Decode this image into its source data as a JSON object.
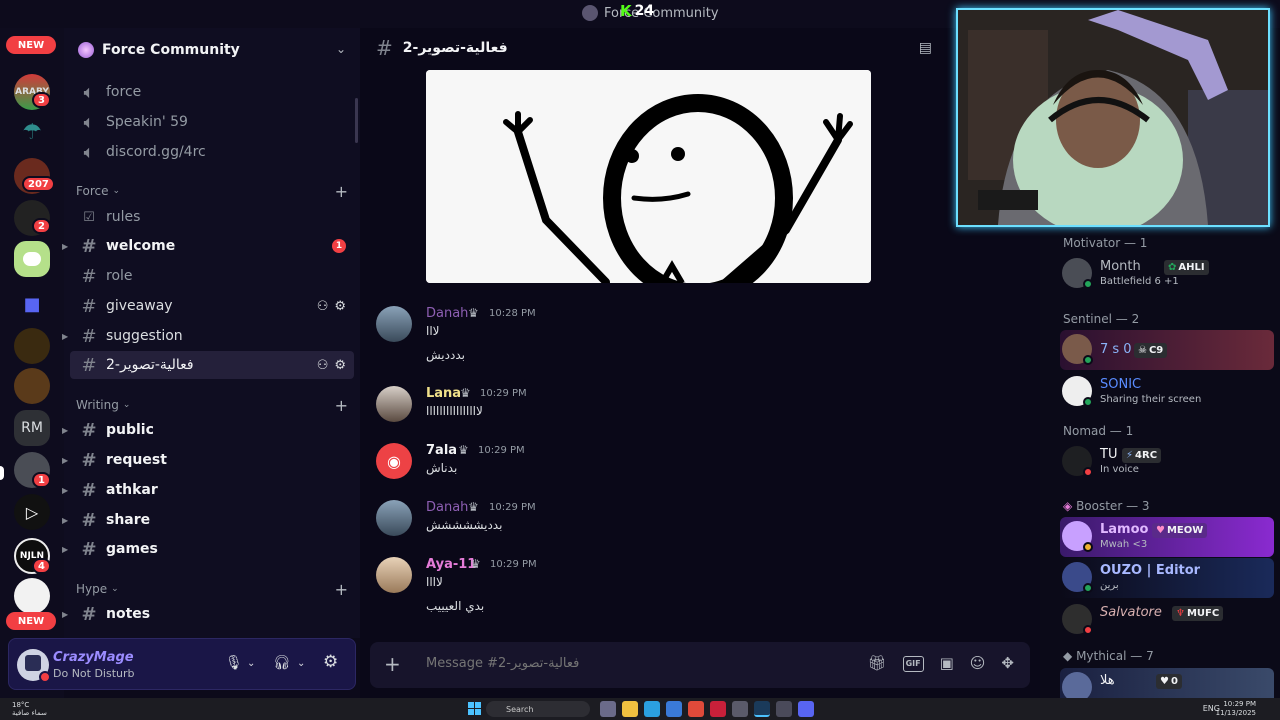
{
  "window": {
    "title": "Force Community",
    "kick_viewers": "24"
  },
  "rail": {
    "new_top": "NEW",
    "new_bottom": "NEW",
    "badges": [
      "3",
      "207",
      "2",
      "1",
      "4"
    ],
    "rm_label": "RM",
    "araby_label": "ARABY"
  },
  "server": {
    "name": "Force Community"
  },
  "channels_top": [
    {
      "label": "force",
      "icon": "speaker-icon"
    },
    {
      "label": "Speakin' 59",
      "icon": "speaker-icon"
    },
    {
      "label": "discord.gg/4rc",
      "icon": "speaker-icon"
    }
  ],
  "categories": {
    "force": "Force",
    "writing": "Writing",
    "hype": "Hype"
  },
  "force_channels": [
    {
      "label": "rules"
    },
    {
      "label": "welcome",
      "mentions": "1"
    },
    {
      "label": "role"
    },
    {
      "label": "giveaway"
    },
    {
      "label": "suggestion"
    },
    {
      "label": "فعالية-تصوير-2"
    }
  ],
  "writing_channels": [
    {
      "label": "public"
    },
    {
      "label": "request"
    },
    {
      "label": "athkar"
    },
    {
      "label": "share"
    },
    {
      "label": "games"
    }
  ],
  "hype_channels": [
    {
      "label": "notes"
    }
  ],
  "user": {
    "name": "CrazyMage",
    "status": "Do Not Disturb"
  },
  "chat": {
    "channel_name": "فعالية-تصوير-2",
    "composer_placeholder": "Message #فعالية-تصوير-2",
    "messages": [
      {
        "author": "Danah",
        "time": "10:28 PM",
        "color": "#8e5fb3",
        "lines": [
          "لااا",
          "بددديش"
        ]
      },
      {
        "author": "Lana",
        "time": "10:29 PM",
        "color": "#f0e08a",
        "lines": [
          "لاااااااااااااااا"
        ]
      },
      {
        "author": "7ala",
        "time": "10:29 PM",
        "color": "#f2f3f5",
        "lines": [
          "بدناش"
        ]
      },
      {
        "author": "Danah",
        "time": "10:29 PM",
        "color": "#8e5fb3",
        "lines": [
          "بدديششششش"
        ]
      },
      {
        "author": "Aya-11",
        "time": "10:29 PM",
        "color": "#e57cd8",
        "lines": [
          "لاااا",
          "بدي العيييب"
        ]
      }
    ]
  },
  "members": {
    "groups": {
      "motivator": "Motivator — 1",
      "sentinel": "Sentinel — 2",
      "nomad": "Nomad — 1",
      "booster": "Booster — 3",
      "mythical": "Mythical — 7"
    },
    "list": [
      {
        "name": "Month",
        "tag": "AHLI",
        "activity": "Battlefield 6 +1"
      },
      {
        "name": "7 s 0",
        "tag": "C9",
        "activity": ""
      },
      {
        "name": "SONIC",
        "tag": "",
        "activity": "Sharing their screen"
      },
      {
        "name": "TU",
        "tag": "4RC",
        "activity": "In voice"
      },
      {
        "name": "Lamoo",
        "tag": "MEOW",
        "activity": "Mwah <3"
      },
      {
        "name": "OUZO | Editor",
        "tag": "",
        "activity": "برين"
      },
      {
        "name": "Salvatore",
        "tag": "MUFC",
        "activity": ""
      },
      {
        "name": "هلا",
        "tag": "0",
        "activity": ""
      }
    ]
  },
  "taskbar": {
    "temp": "18°C",
    "weather": "سماء صافية",
    "search": "Search",
    "lang": "ENG",
    "time": "10:29 PM",
    "date": "11/13/2025"
  }
}
